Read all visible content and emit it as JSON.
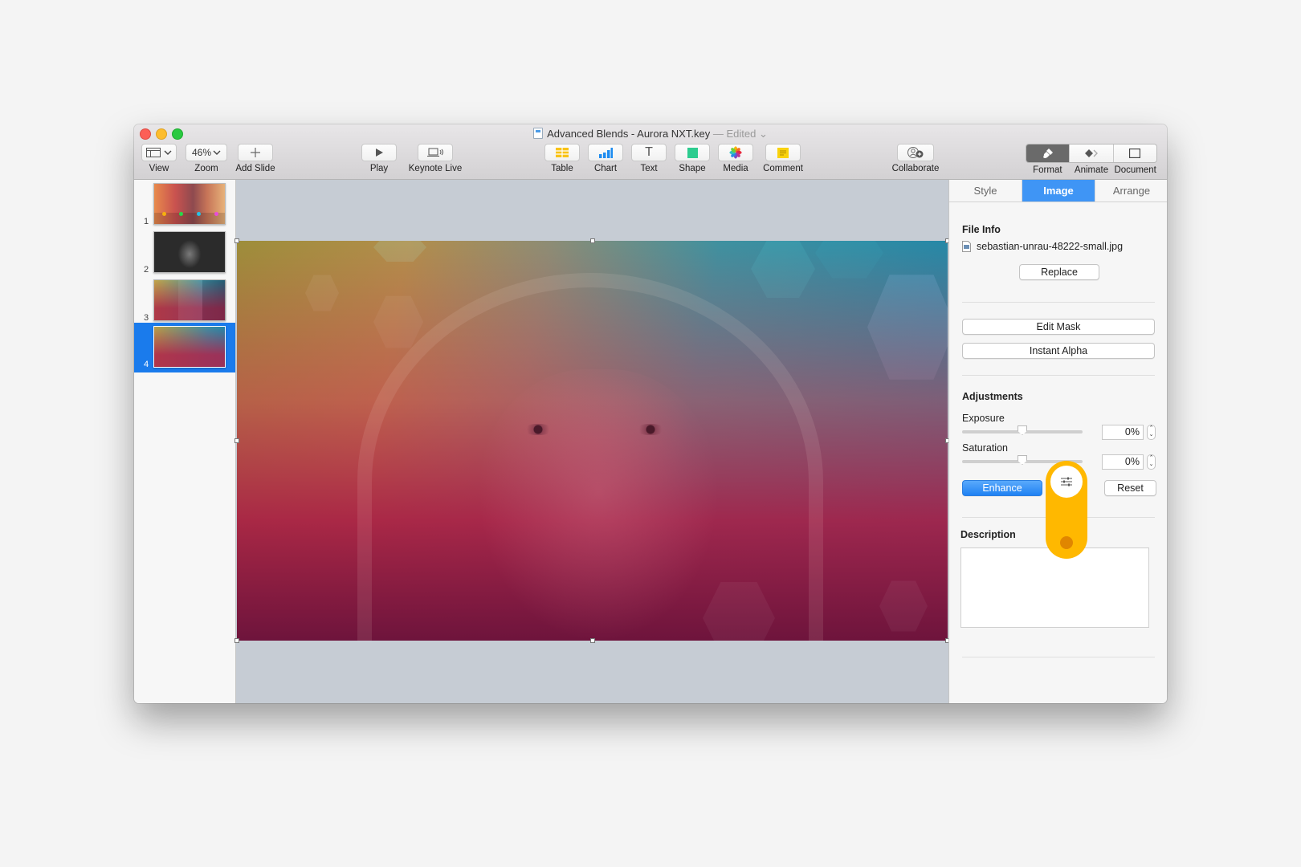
{
  "window": {
    "title": "Advanced Blends - Aurora NXT.key",
    "status": "— Edited",
    "status_chevron": "⌄"
  },
  "toolbar": {
    "view": {
      "label": "View",
      "icon": "sidebar-layout-icon"
    },
    "zoom": {
      "label": "Zoom",
      "value": "46%"
    },
    "add_slide": {
      "label": "Add Slide",
      "icon": "plus-icon"
    },
    "play": {
      "label": "Play",
      "icon": "play-icon"
    },
    "keynote_live": {
      "label": "Keynote Live",
      "icon": "laptop-broadcast-icon"
    },
    "table": {
      "label": "Table",
      "icon": "table-icon"
    },
    "chart": {
      "label": "Chart",
      "icon": "bar-chart-icon"
    },
    "text": {
      "label": "Text",
      "icon": "text-icon",
      "glyph": "T"
    },
    "shape": {
      "label": "Shape",
      "icon": "square-shape-icon"
    },
    "media": {
      "label": "Media",
      "icon": "photos-flower-icon"
    },
    "comment": {
      "label": "Comment",
      "icon": "comment-note-icon"
    },
    "collaborate": {
      "label": "Collaborate",
      "icon": "add-person-icon"
    },
    "format": {
      "label": "Format",
      "icon": "paintbrush-icon",
      "active": true
    },
    "animate": {
      "label": "Animate",
      "icon": "diamond-icon"
    },
    "document": {
      "label": "Document",
      "icon": "document-icon"
    }
  },
  "slides": [
    {
      "number": "1",
      "selected": false
    },
    {
      "number": "2",
      "selected": false
    },
    {
      "number": "3",
      "selected": false
    },
    {
      "number": "4",
      "selected": true
    }
  ],
  "inspector": {
    "tabs": [
      {
        "label": "Style",
        "active": false
      },
      {
        "label": "Image",
        "active": true
      },
      {
        "label": "Arrange",
        "active": false
      }
    ],
    "file_info": {
      "heading": "File Info",
      "filename": "sebastian-unrau-48222-small.jpg",
      "replace_label": "Replace"
    },
    "edit_mask_label": "Edit Mask",
    "instant_alpha_label": "Instant Alpha",
    "adjustments": {
      "heading": "Adjustments",
      "exposure": {
        "label": "Exposure",
        "value": "0%",
        "slider_fraction": 0.5
      },
      "saturation": {
        "label": "Saturation",
        "value": "0%",
        "slider_fraction": 0.5
      },
      "enhance_label": "Enhance",
      "reset_label": "Reset",
      "advanced_icon": "sliders-icon"
    },
    "description": {
      "heading": "Description",
      "value": ""
    }
  },
  "colors": {
    "accent": "#3f95f5",
    "selection": "#1a7bec",
    "pointer": "#ffb800",
    "pointer_dot": "#e08600"
  }
}
